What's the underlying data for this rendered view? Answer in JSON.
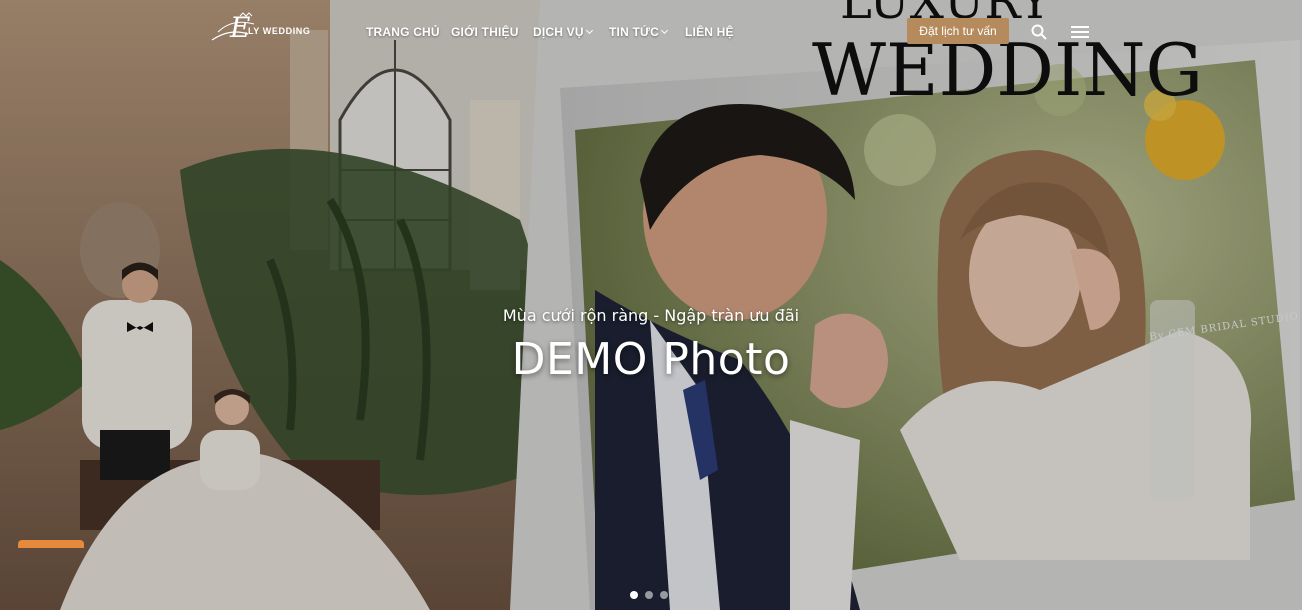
{
  "brand": {
    "logo_text": "LY WEDDING",
    "logo_letter": "E"
  },
  "nav": {
    "items": [
      {
        "label": "TRANG CHỦ",
        "has_dropdown": false
      },
      {
        "label": "GIỚI THIỆU",
        "has_dropdown": false
      },
      {
        "label": "DỊCH VỤ",
        "has_dropdown": true
      },
      {
        "label": "TIN TỨC",
        "has_dropdown": true
      },
      {
        "label": "LIÊN HỆ",
        "has_dropdown": false
      }
    ],
    "cta_label": "Đặt lịch tư vấn",
    "icons": [
      "search-icon",
      "hamburger-menu-icon"
    ]
  },
  "hero": {
    "subtitle": "Mùa cưới rộn ràng - Ngập tràn ưu đãi",
    "title": "DEMO Photo",
    "magazine_title": "WEDDING",
    "magazine_top_text": "LUXURY",
    "magazine_credit": "By CEM BRIDAL STUDIO",
    "slides": {
      "count": 3,
      "active": 1
    }
  },
  "colors": {
    "accent": "#b58b5e",
    "tab": "#e58a3c"
  }
}
